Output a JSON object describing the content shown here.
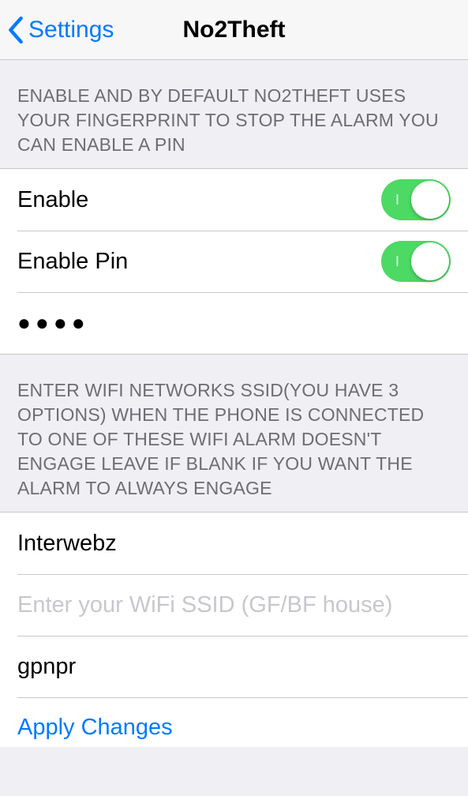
{
  "nav": {
    "back_label": "Settings",
    "title": "No2Theft"
  },
  "section1": {
    "header": "Enable and by default No2Theft uses your fingerprint to stop the alarm you can enable a pin",
    "rows": {
      "enable_label": "Enable",
      "enable_on": true,
      "enable_pin_label": "Enable Pin",
      "enable_pin_on": true,
      "pin_masked": "●●●●"
    }
  },
  "section2": {
    "header": "Enter WiFi networks SSID(you have 3 options) when the phone is connected to one of these WiFi alarm doesn't engage leave if blank if you want the alarm to always engage",
    "ssid1": "Interwebz",
    "ssid2": "",
    "ssid2_placeholder": "Enter your WiFi SSID (GF/BF house)",
    "ssid3": "gpnpr",
    "apply_label": "Apply Changes"
  }
}
